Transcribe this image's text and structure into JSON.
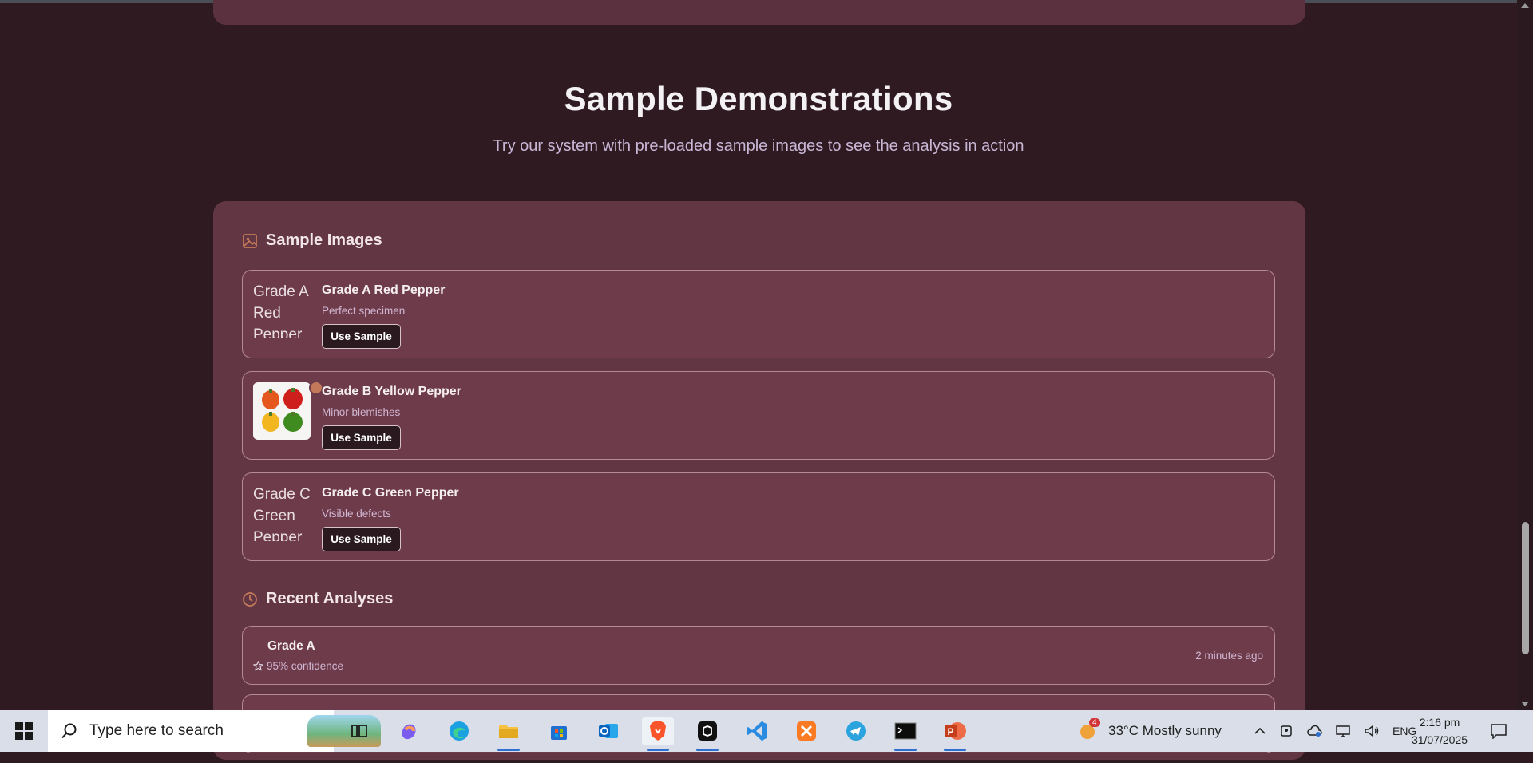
{
  "section": {
    "title": "Sample Demonstrations",
    "subtitle": "Try our system with pre-loaded sample images to see the analysis in action"
  },
  "sample_images": {
    "heading": "Sample Images",
    "items": [
      {
        "title": "Grade A Red Pepper",
        "desc": "Perfect specimen",
        "alt": "Grade A Red Pepper",
        "button": "Use Sample"
      },
      {
        "title": "Grade B Yellow Pepper",
        "desc": "Minor blemishes",
        "alt": "",
        "button": "Use Sample"
      },
      {
        "title": "Grade C Green Pepper",
        "desc": "Visible defects",
        "alt": "Grade C Green Pepper",
        "button": "Use Sample"
      }
    ]
  },
  "recent_analyses": {
    "heading": "Recent Analyses",
    "items": [
      {
        "grade": "Grade A",
        "confidence": "95% confidence",
        "time": "2 minutes ago"
      }
    ]
  },
  "taskbar": {
    "search_placeholder": "Type here to search",
    "weather_badge": "4",
    "weather": "33°C  Mostly sunny",
    "language": "ENG",
    "time": "2:16 pm",
    "date": "31/07/2025"
  },
  "colors": {
    "page_bg": "#2e1a20",
    "panel_bg": "#633644",
    "card_bg": "#6e3b4a",
    "accent": "#c47a5a"
  }
}
